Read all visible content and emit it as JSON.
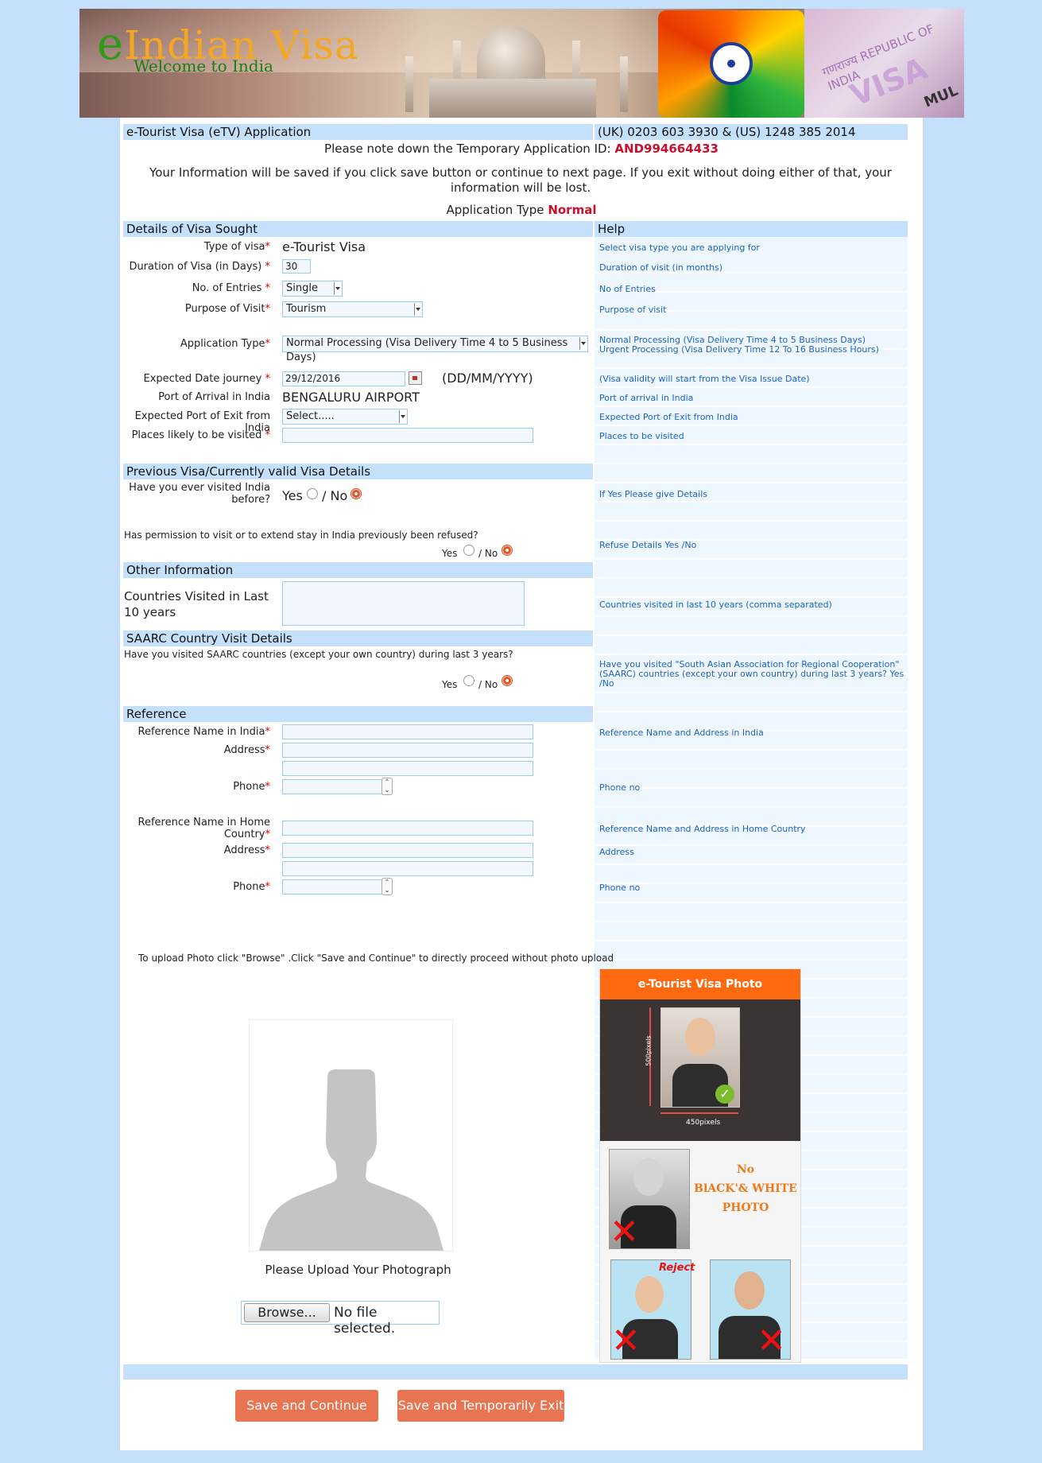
{
  "banner": {
    "title_e": "e",
    "title_rest": "Indian Visa",
    "subtitle": "Welcome to India",
    "passport_text": "गणराज्य REPUBLIC OF INDIA",
    "passport_visa": "VISA",
    "passport_mul": "MUL"
  },
  "header": {
    "app_title": "e-Tourist Visa (eTV) Application",
    "phones": "(UK) 0203 603 3930 & (US) 1248 385 2014"
  },
  "notice": {
    "temp_id_label": "Please note down the Temporary Application ID:",
    "temp_id_value": "AND994664433",
    "save_info": "Your Information will be saved if you click save button or continue to next page. If you exit without doing either of that, your information will be lost.",
    "app_type_label": "Application Type",
    "app_type_value": "Normal"
  },
  "sections": {
    "visa_sought": "Details of Visa Sought",
    "help": "Help",
    "previous_visa": "Previous Visa/Currently valid Visa Details",
    "other_info": "Other Information",
    "saarc": "SAARC Country Visit Details",
    "reference": "Reference"
  },
  "fields": {
    "type_of_visa_label": "Type of visa",
    "type_of_visa_value": "e-Tourist Visa",
    "duration_label": "Duration of Visa (in Days)",
    "duration_value": "30",
    "entries_label": "No. of Entries",
    "entries_value": "Single",
    "purpose_label": "Purpose of Visit",
    "purpose_value": "Tourism",
    "app_type_label": "Application Type",
    "app_type_value": "Normal Processing (Visa Delivery Time 4 to 5 Business Days)",
    "journey_label": "Expected Date journey",
    "journey_value": "29/12/2016",
    "journey_format": "(DD/MM/YYYY)",
    "arrival_label": "Port of Arrival in India",
    "arrival_value": "BENGALURU AIRPORT",
    "exit_label": "Expected Port of Exit from India",
    "exit_value": "Select.....",
    "places_label": "Places likely to be visited",
    "visited_before_label": "Have you ever visited India before?",
    "yes": "Yes",
    "slash_no": "/ No",
    "refused_label": "Has permission to visit or to extend stay in India previously been refused?",
    "countries_label": "Countries Visited in Last 10 years",
    "saarc_label": "Have you visited SAARC countries (except your own country) during last 3 years?",
    "ref_name_india_label": "Reference Name in India",
    "address_label": "Address",
    "phone_label": "Phone",
    "ref_name_home_label": "Reference Name in Home Country"
  },
  "help": {
    "type_of_visa": "Select visa type you are applying for",
    "duration": "Duration of visit (in months)",
    "entries": "No of Entries",
    "purpose": "Purpose of visit",
    "app_type_1": "Normal Processing (Visa Delivery Time 4 to 5 Business Days)",
    "app_type_2": "Urgent Processing (Visa Delivery Time 12 To 16 Business Hours)",
    "journey": "(Visa validity will start from the Visa Issue Date)",
    "arrival": "Port of arrival in India",
    "exit": "Expected Port of Exit from India",
    "places": "Places to be visited",
    "visited_before": "If Yes Please give Details",
    "refused": "Refuse Details Yes /No",
    "countries": "Countries visited in last 10 years (comma separated)",
    "saarc": "Have you visited \"South Asian Association for Regional Cooperation\" (SAARC) countries (except your own country) during last 3 years? Yes /No",
    "ref_india": "Reference Name and Address in India",
    "phone": "Phone no",
    "ref_home": "Reference Name and Address in Home Country",
    "address": "Address",
    "phone2": "Phone no"
  },
  "upload": {
    "instruction": "To upload Photo click \"Browse\" .Click \"Save and Continue\" to directly proceed without photo upload",
    "caption": "Please Upload Your Photograph",
    "browse": "Browse...",
    "no_file": "No file selected."
  },
  "photo_req": {
    "title": "e-Tourist Visa Photo Requirmennt",
    "height_px": "500pixels",
    "width_px": "450pixels",
    "bw_line1": "No",
    "bw_line2": "BlACK'& WHITE",
    "bw_line3": "PHOTO",
    "reject": "Reject"
  },
  "buttons": {
    "save_continue": "Save and Continue",
    "save_exit": "Save and Temporarily Exit"
  },
  "colors": {
    "accent_red": "#c8102e",
    "help_blue": "#1a63c6",
    "button": "#e97452",
    "section_bar": "#c5e0fb"
  }
}
